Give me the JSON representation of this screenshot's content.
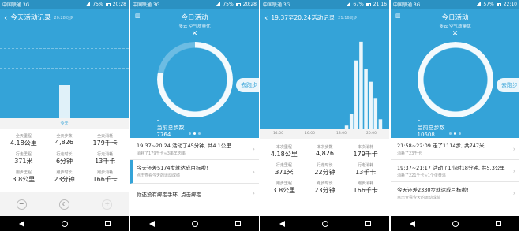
{
  "panel1": {
    "status": {
      "carrier": "中国联通 3G",
      "battery": "75%",
      "time": "20:28"
    },
    "title": "今天活动记录",
    "subtitle": "20:28同步",
    "chart_data": {
      "type": "bar",
      "categories": [
        "今天"
      ],
      "values": [
        1
      ],
      "xlabel": "",
      "ylabel": ""
    },
    "bar_label": "今天",
    "stats": [
      {
        "label": "全天里程",
        "value": "4.18公里"
      },
      {
        "label": "全天步数",
        "value": "4,826"
      },
      {
        "label": "全天消耗",
        "value": "179千卡"
      },
      {
        "label": "行走里程",
        "value": "371米"
      },
      {
        "label": "行走时长",
        "value": "6分钟"
      },
      {
        "label": "行走消耗",
        "value": "13千卡"
      },
      {
        "label": "跑步里程",
        "value": "3.8公里"
      },
      {
        "label": "跑步时长",
        "value": "23分钟"
      },
      {
        "label": "跑步消耗",
        "value": "166千卡"
      }
    ],
    "buttons": {
      "minus": "−",
      "moon": "☾",
      "plus": "+"
    }
  },
  "panel2": {
    "status": {
      "carrier": "中国联通 3G",
      "battery": "75%",
      "time": "20:28"
    },
    "title": "今日活动",
    "weather": "多云 空气质量优",
    "ring": {
      "caption": "当前总步数",
      "steps": "7764",
      "distance": "6.72公里",
      "calories": "287千卡",
      "progress": 0.78
    },
    "run_button": "去跑步",
    "rows": [
      {
        "title": "19:37~20:24 活动了45分钟, 共4.1公里",
        "sub": "消耗了179千卡≈3串羊肉串"
      },
      {
        "title": "今天还差5174步就达成目标啦!",
        "sub": "点击查看今天的运动成绩"
      },
      {
        "title": "你还没有绑定手环, 点击绑定",
        "sub": ""
      }
    ]
  },
  "panel3": {
    "status": {
      "carrier": "中国联通 3G",
      "battery": "67%",
      "time": "21:16"
    },
    "title": "19:37至20:24活动记录",
    "subtitle": "21:16同步",
    "chart_data": {
      "type": "bar",
      "categories": [
        "14:00",
        "16:00",
        "18:00",
        "20:00"
      ],
      "values": [
        0,
        0,
        0,
        0,
        0,
        0,
        0,
        0,
        0,
        0,
        0,
        0,
        0,
        0,
        0,
        0,
        3,
        12,
        55,
        70,
        48,
        38,
        25,
        8
      ],
      "xlabel": "",
      "ylabel": ""
    },
    "ticks": [
      "14:00",
      "16:00",
      "18:00",
      "20:00"
    ],
    "stats": [
      {
        "label": "本次里程",
        "value": "4.18公里"
      },
      {
        "label": "本次步数",
        "value": "4,826"
      },
      {
        "label": "本次消耗",
        "value": "179千卡"
      },
      {
        "label": "行走里程",
        "value": "371米"
      },
      {
        "label": "行走时长",
        "value": "22分钟"
      },
      {
        "label": "行走消耗",
        "value": "13千卡"
      },
      {
        "label": "跑步里程",
        "value": "3.8公里"
      },
      {
        "label": "跑步时长",
        "value": "23分钟"
      },
      {
        "label": "跑步消耗",
        "value": "166千卡"
      }
    ]
  },
  "panel4": {
    "status": {
      "carrier": "中国联通 3G",
      "battery": "57%",
      "time": "22:10"
    },
    "title": "今日活动",
    "weather": "多云 空气质量优",
    "ring": {
      "caption": "当前总步数",
      "steps": "10608",
      "distance": "8.4公里",
      "calories": "337千卡",
      "progress": 1.0
    },
    "run_button": "去跑步",
    "rows": [
      {
        "title": "21:58~22:09 走了1114步, 共747米",
        "sub": "消耗了23千卡"
      },
      {
        "title": "19:37~21:17 活动了1小时18分钟, 共5.3公里",
        "sub": "消耗了221千卡≈1个蛋黄派"
      },
      {
        "title": "今天还差2330步就达成目标啦!",
        "sub": "点击查看今天的运动成绩"
      }
    ]
  },
  "colors": {
    "primary": "#34a3d8",
    "statusbar": "#2b91c2",
    "navbar": "#000000"
  }
}
